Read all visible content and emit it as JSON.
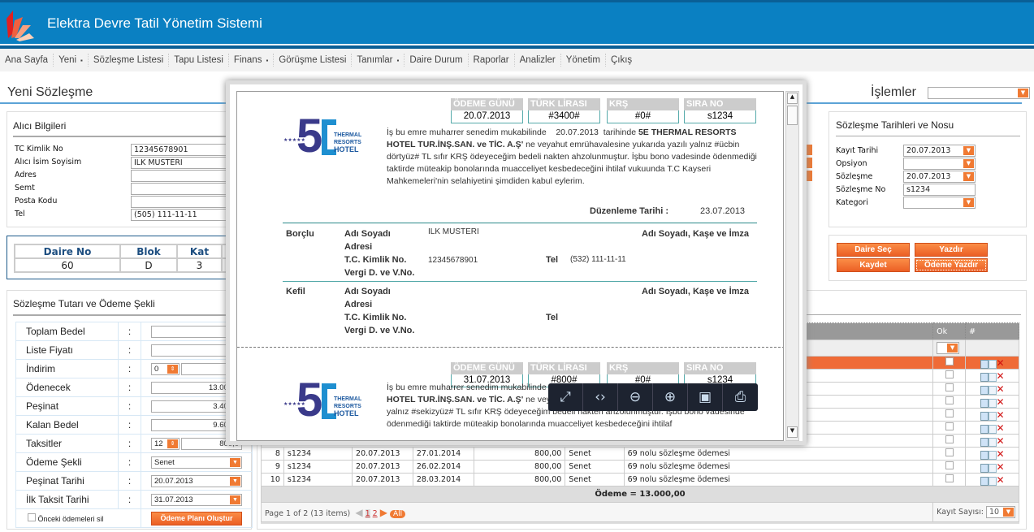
{
  "app": {
    "title": "Elektra Devre Tatil Yönetim Sistemi"
  },
  "menu": [
    {
      "label": "Ana Sayfa"
    },
    {
      "label": "Yeni",
      "dropdown": true
    },
    {
      "label": "Sözleşme Listesi"
    },
    {
      "label": "Tapu Listesi"
    },
    {
      "label": "Finans",
      "dropdown": true
    },
    {
      "label": "Görüşme Listesi"
    },
    {
      "label": "Tanımlar",
      "dropdown": true
    },
    {
      "label": "Daire Durum"
    },
    {
      "label": "Raporlar"
    },
    {
      "label": "Analizler"
    },
    {
      "label": "Yönetim"
    },
    {
      "label": "Çıkış"
    }
  ],
  "page": {
    "title": "Yeni Sözleşme",
    "actions_label": "İşlemler",
    "actions_value": ""
  },
  "buyer": {
    "title": "Alıcı Bilgileri",
    "fields": [
      {
        "label": "TC Kimlik No",
        "value": "12345678901"
      },
      {
        "label": "Alıcı İsim Soyisim",
        "value": "ILK MUSTERI"
      },
      {
        "label": "Adres",
        "value": ""
      },
      {
        "label": "Semt",
        "value": ""
      },
      {
        "label": "Posta Kodu",
        "value": ""
      },
      {
        "label": "Tel",
        "value": "(505) 111-11-11"
      }
    ]
  },
  "unit": {
    "headers": [
      "Daire No",
      "Blok",
      "Kat"
    ],
    "values": [
      "60",
      "D",
      "3"
    ]
  },
  "payment": {
    "title": "Sözleşme Tutarı ve Ödeme Şekli",
    "rows": [
      {
        "label": "Toplam Bedel",
        "value": ""
      },
      {
        "label": "Liste Fiyatı",
        "value": "0,0"
      },
      {
        "label": "İndirim",
        "spin": "0",
        "value": "0,0"
      },
      {
        "label": "Ödenecek",
        "value": "13.000,0"
      },
      {
        "label": "Peşinat",
        "value": "3.400,0"
      },
      {
        "label": "Kalan Bedel",
        "value": "9.600,0"
      },
      {
        "label": "Taksitler",
        "spin": "12",
        "value": "800,0"
      },
      {
        "label": "Ödeme Şekli",
        "value": "Senet"
      },
      {
        "label": "Peşinat Tarihi",
        "value": "20.07.2013"
      },
      {
        "label": "İlk Taksit Tarihi",
        "value": "31.07.2013"
      }
    ],
    "colon": ":",
    "delete_prev": "Önceki ödemeleri sil",
    "create_plan": "Ödeme Planı Oluştur"
  },
  "dates": {
    "title": "Sözleşme Tarihleri ve Nosu",
    "fields": [
      {
        "label": "Kayıt Tarihi",
        "value": "20.07.2013"
      },
      {
        "label": "Opsiyon",
        "value": ""
      },
      {
        "label": "Sözleşme",
        "value": "20.07.2013"
      },
      {
        "label": "Sözleşme No",
        "value": "s1234"
      },
      {
        "label": "Kategori",
        "value": ""
      }
    ]
  },
  "buttons": {
    "select_unit": "Daire Seç",
    "print": "Yazdır",
    "save": "Kaydet",
    "print_payment": "Ödeme Yazdır"
  },
  "grid": {
    "headers": {
      "ok": "Ok",
      "actions": "#"
    },
    "rows": [
      {
        "no": "8",
        "contract": "s1234",
        "date": "20.07.2013",
        "due": "27.01.2014",
        "amount": "800,00",
        "type": "Senet",
        "desc": "69 nolu sözleşme ödemesi"
      },
      {
        "no": "9",
        "contract": "s1234",
        "date": "20.07.2013",
        "due": "26.02.2014",
        "amount": "800,00",
        "type": "Senet",
        "desc": "69 nolu sözleşme ödemesi"
      },
      {
        "no": "10",
        "contract": "s1234",
        "date": "20.07.2013",
        "due": "28.03.2014",
        "amount": "800,00",
        "type": "Senet",
        "desc": "69 nolu sözleşme ödemesi"
      }
    ],
    "total": "Ödeme = 13.000,00",
    "pager": {
      "info": "Page 1 of 2 (13 items)",
      "pages": [
        "1",
        "2"
      ],
      "all": "All"
    },
    "page_size_label": "Kayıt Sayısı:",
    "page_size": "10"
  },
  "preview": {
    "notes": [
      {
        "headers": [
          "ÖDEME GÜNÜ",
          "TÜRK LİRASI",
          "KRŞ",
          "SIRA NO"
        ],
        "values": [
          "20.07.2013",
          "#3400#",
          "#0#",
          "s1234"
        ],
        "p1": "İş bu emre muharrer senedim mukabilinde",
        "date": "20.07.2013",
        "p2": "tarihinde",
        "company": "5E THERMAL RESORTS HOTEL TUR.İNŞ.SAN. ve TİC. A.Ş'",
        "p3": "ne veyahut emrühavalesine yukarıda yazılı yalnız",
        "words": "#ücbin dörtyüz#",
        "p4": "TL   sıfır KRŞ ödeyeceğim bedeli nakten ahzolunmuştur. İşbu bono vadesinde ödenmediği taktirde müteakip bonolarında muacceliyet kesbedeceğini ihtilaf vukuunda T.C Kayseri Mahkemeleri'nin selahiyetini şimdiden kabul eylerim.",
        "issue_label": "Düzenleme Tarihi :",
        "issue_date": "23.07.2013",
        "debtor": {
          "title": "Borçlu",
          "name_label": "Adı Soyadı",
          "addr_label": "Adresi",
          "id_label": "T.C. Kimlik No.",
          "tax_label": "Vergi D. ve V.No.",
          "name": "ILK MUSTERI",
          "id": "12345678901",
          "tel_label": "Tel",
          "tel": "(532) 111-11-11",
          "sign": "Adı Soyadı, Kaşe ve İmza"
        },
        "guarantor": {
          "title": "Kefil",
          "name_label": "Adı Soyadı",
          "addr_label": "Adresi",
          "id_label": "T.C. Kimlik No.",
          "tax_label": "Vergi D. ve V.No.",
          "tel_label": "Tel",
          "sign": "Adı Soyadı, Kaşe ve İmza"
        }
      },
      {
        "headers": [
          "ÖDEME GÜNÜ",
          "TÜRK LİRASI",
          "KRŞ",
          "SIRA NO"
        ],
        "values": [
          "31.07.2013",
          "#800#",
          "#0#",
          "s1234"
        ],
        "p1": "İş bu emre muharrer senedim mukabilinde",
        "company": "HOTEL TUR.İNŞ.SAN. ve TİC. A.Ş'",
        "p3": "ne veyahut emrühavalesine yukarıda yazılı",
        "words": "yalnız  #sekizyüz#  TL   sıfır KRŞ ödeyeceğim bedeli nakten ahzolunmuştur. İşbu bono vadesinde ödenmediği taktirde müteakip bonolarında muacceliyet kesbedeceğini ihtilaf"
      }
    ],
    "logo": {
      "text1": "THERMAL",
      "text2": "RESORTS",
      "text3": "HOTEL",
      "big": "5E"
    },
    "toolbar": [
      "fit-page-icon",
      "fit-width-icon",
      "zoom-out-icon",
      "zoom-in-icon",
      "save-icon",
      "print-icon"
    ]
  },
  "colors": {
    "header": "#0a80c2",
    "accent": "#f07a33",
    "selected_row": "#ef6b37"
  }
}
